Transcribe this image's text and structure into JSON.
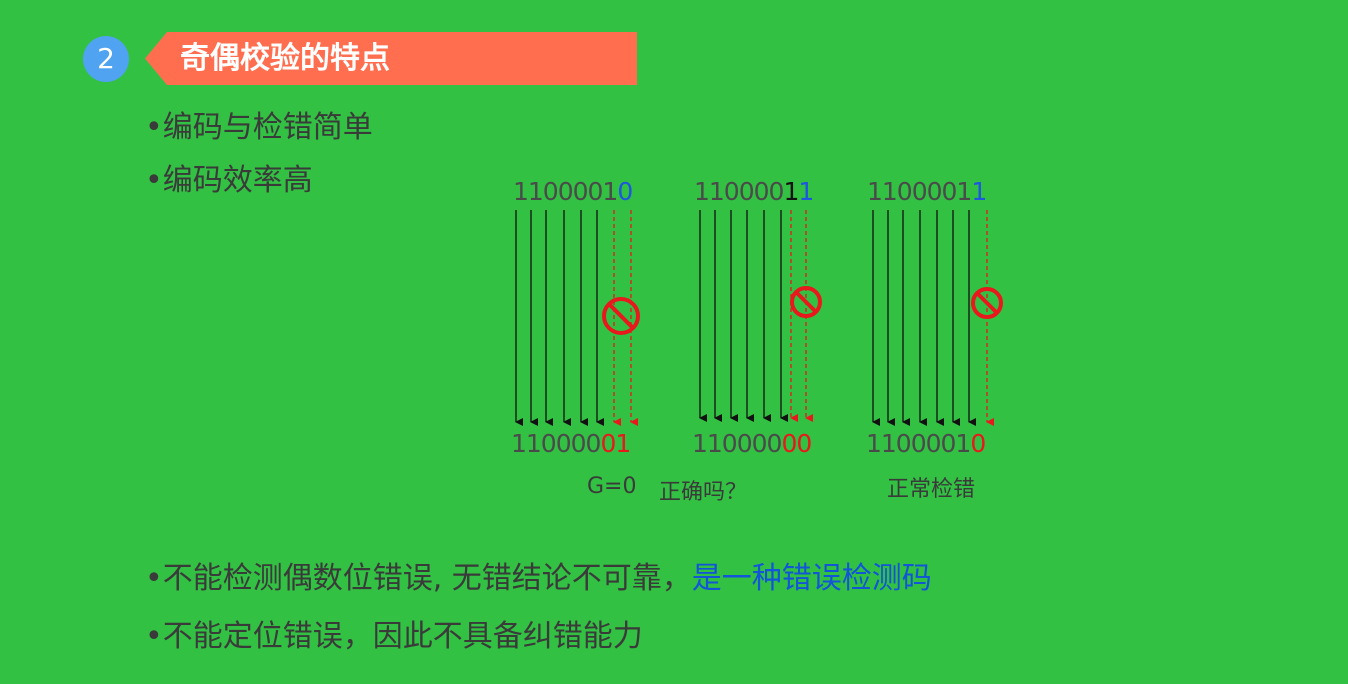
{
  "section": {
    "number": "2",
    "title": "奇偶校验的特点"
  },
  "bullets_top": [
    "•编码与检错简单",
    "•编码效率高"
  ],
  "diagram": {
    "groups": [
      {
        "top_prefix": "1100001",
        "top_suffix": "0",
        "top_suffix_color": "blue",
        "bottom_prefix": "110000",
        "bottom_suffix": "01"
      },
      {
        "top_prefix": "110000",
        "top_mid": "1",
        "top_suffix": "1",
        "bottom_prefix": "110000",
        "bottom_suffix": "00"
      },
      {
        "top_prefix": "1100001",
        "top_suffix": "1",
        "bottom_prefix": "1100001",
        "bottom_suffix": "0"
      }
    ],
    "captions": {
      "g_value": "G=0",
      "question": "正确吗？",
      "normal": "正常检错"
    }
  },
  "bullets_bottom": {
    "line1_prefix": "•不能检测偶数位错误, 无错结论不可靠，",
    "line1_highlight": "是一种错误检测码",
    "line2": "•不能定位错误，因此不具备纠错能力"
  },
  "colors": {
    "background": "#33c143",
    "banner": "#ff6e4f",
    "badge": "#4fa3f0",
    "highlight": "#1255d9",
    "error": "#e8181c"
  }
}
